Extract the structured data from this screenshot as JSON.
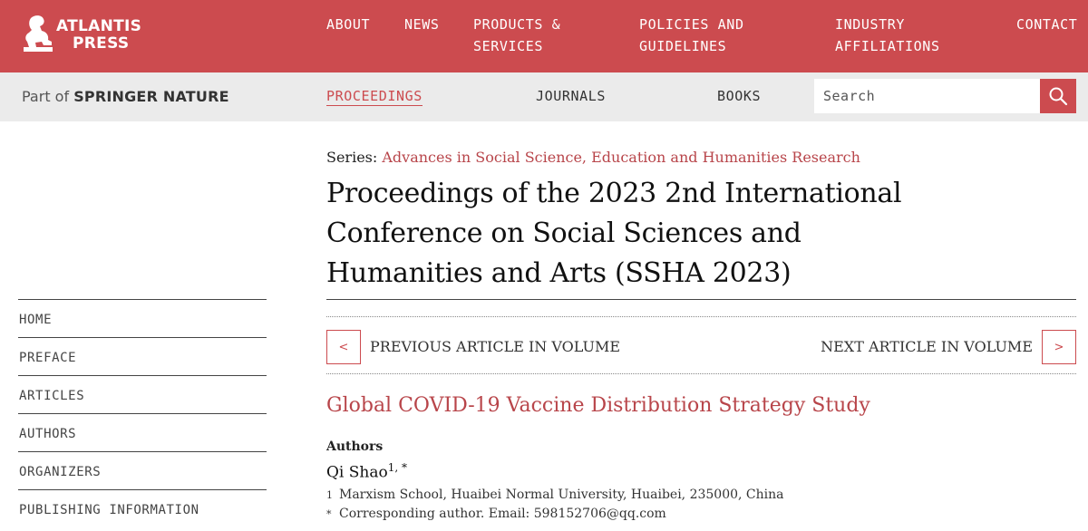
{
  "header": {
    "logo_line1": "ATLANTIS",
    "logo_line2": "PRESS",
    "nav": {
      "about": "ABOUT",
      "news": "NEWS",
      "products_1": "PRODUCTS &",
      "products_2": "SERVICES",
      "policies_1": "POLICIES AND",
      "policies_2": "GUIDELINES",
      "industry_1": "INDUSTRY",
      "industry_2": "AFFILIATIONS",
      "contact": "CONTACT"
    }
  },
  "subbar": {
    "part_of": "Part of",
    "springer": "SPRINGER NATURE",
    "proceedings": "PROCEEDINGS",
    "journals": "JOURNALS",
    "books": "BOOKS",
    "search_placeholder": "Search"
  },
  "sidebar": {
    "items": [
      {
        "label": "HOME"
      },
      {
        "label": "PREFACE"
      },
      {
        "label": "ARTICLES"
      },
      {
        "label": "AUTHORS"
      },
      {
        "label": "ORGANIZERS"
      },
      {
        "label": "PUBLISHING INFORMATION"
      }
    ]
  },
  "main": {
    "series_label": "Series:",
    "series_link": "Advances in Social Science, Education and Humanities Research",
    "proceedings_title": "Proceedings of the 2023 2nd International Conference on Social Sciences and Humanities and Arts (SSHA 2023)",
    "prev_symbol": "<",
    "prev_label": "PREVIOUS ARTICLE IN VOLUME",
    "next_label": "NEXT ARTICLE IN VOLUME",
    "next_symbol": ">",
    "article_title": "Global COVID-19 Vaccine Distribution Strategy Study",
    "authors_heading": "Authors",
    "author_name": "Qi Shao",
    "author_marks": "1, *",
    "affiliations": [
      {
        "marker": "1",
        "text": "Marxism School, Huaibei Normal University, Huaibei, 235000, China"
      },
      {
        "marker": "*",
        "text": "Corresponding author. Email: 598152706@qq.com"
      }
    ]
  },
  "colors": {
    "brand_red": "#cc4b4f",
    "link_red": "#b8454a",
    "subbar_gray": "#ebebeb"
  }
}
